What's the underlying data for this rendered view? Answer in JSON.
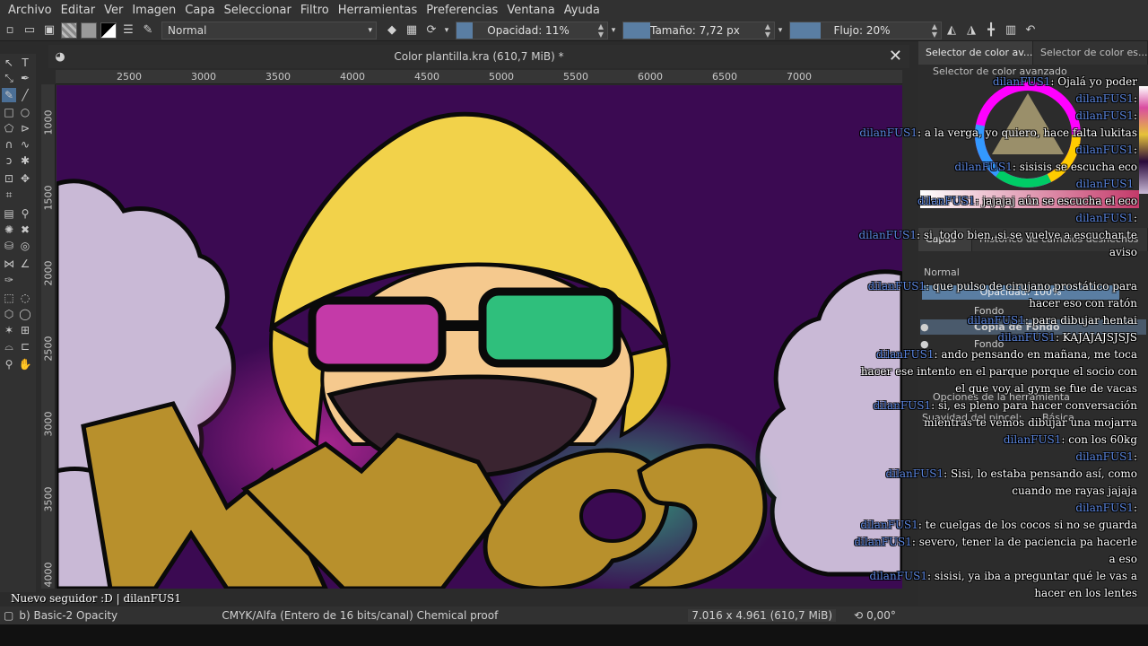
{
  "menu": [
    "Archivo",
    "Editar",
    "Ver",
    "Imagen",
    "Capa",
    "Seleccionar",
    "Filtro",
    "Herramientas",
    "Preferencias",
    "Ventana",
    "Ayuda"
  ],
  "toolbar": {
    "blend_mode": "Normal",
    "opacity_label": "Opacidad: 11%",
    "opacity_value": 0.11,
    "size_label": "Tamaño: 7,72 px",
    "flow_label": "Flujo: 20%",
    "flow_value": 0.2
  },
  "document": {
    "title": "Color plantilla.kra (610,7 MiB) *",
    "close_icon": "✕"
  },
  "ruler": {
    "top_labels": [
      "2500",
      "3000",
      "3500",
      "4000",
      "4500",
      "5000",
      "5500",
      "6000",
      "6500",
      "7000"
    ],
    "left_labels": [
      "1000",
      "1500",
      "2000",
      "2500",
      "3000",
      "3500",
      "4000"
    ]
  },
  "right_panel": {
    "tabs": [
      "Selector de color av...",
      "Selector de color es..."
    ],
    "advanced_selector_title": "Selector de color avanzado",
    "layers_tabs": [
      "Capas",
      "Histórico de cambios deshechos"
    ],
    "layers_blend": "Normal",
    "layers_opacity": "Opacidad:  100%",
    "layers": [
      {
        "name": "Fondo"
      },
      {
        "name": "Copia de Fondo"
      },
      {
        "name": "Fondo"
      }
    ],
    "tool_options_title": "Opciones de la herramienta",
    "brush_smoothing_label": "Suavidad del pincel:",
    "brush_smoothing_value": "Básica"
  },
  "chat": [
    {
      "user": "dilanFUS1",
      "text": ": Ojalá yo poder"
    },
    {
      "user": "dilanFUS1",
      "text": ":"
    },
    {
      "user": "dilanFUS1",
      "text": ":"
    },
    {
      "user": "dilanFUS1",
      "text": ": a la verga, yo quiero, hace falta lukitas"
    },
    {
      "user": "dilanFUS1",
      "text": ":"
    },
    {
      "user": "dilanFUS1",
      "text": ": sisisis se escucha eco"
    },
    {
      "user": "dilanFUS1",
      "text": ""
    },
    {
      "user": "dilanFUS1",
      "text": ": jajajaj aún se escucha el eco"
    },
    {
      "user": "dilanFUS1",
      "text": ":"
    },
    {
      "user": "dilanFUS1",
      "text": ": si, todo bien, si se vuelve a escuchar te"
    },
    {
      "user": "",
      "text": "aviso"
    },
    {
      "user": "",
      "text": ""
    },
    {
      "user": "dilanFUS1",
      "text": ": que pulso de cirujano prostático para"
    },
    {
      "user": "",
      "text": "hacer eso con ratón"
    },
    {
      "user": "dilanFUS1",
      "text": ": para dibujar hentai"
    },
    {
      "user": "dilanFUS1",
      "text": ": KAJAJAJSJSJS"
    },
    {
      "user": "dilanFUS1",
      "text": ": ando pensando en mañana, me toca"
    },
    {
      "user": "",
      "text": "hacer ese intento en el parque porque el socio con"
    },
    {
      "user": "",
      "text": "el que voy al gym se fue de vacas"
    },
    {
      "user": "dilanFUS1",
      "text": ": si, es pleno para hacer conversación"
    },
    {
      "user": "",
      "text": "mientras te vemos dibujar una mojarra"
    },
    {
      "user": "dilanFUS1",
      "text": ": con los 60kg"
    },
    {
      "user": "dilanFUS1",
      "text": ":"
    },
    {
      "user": "dilanFUS1",
      "text": ": Sisi, lo estaba pensando así, como"
    },
    {
      "user": "",
      "text": "cuando me rayas jajaja"
    },
    {
      "user": "dilanFUS1",
      "text": ":"
    },
    {
      "user": "dilanFUS1",
      "text": ": te cuelgas de los cocos si no se guarda"
    },
    {
      "user": "dilanFUS1",
      "text": ": severo, tener la de paciencia pa hacerle"
    },
    {
      "user": "",
      "text": "a eso"
    },
    {
      "user": "dilanFUS1",
      "text": ": sisisi, ya iba a preguntar qué le vas a"
    },
    {
      "user": "",
      "text": "hacer en los lentes"
    }
  ],
  "follow_alert": "Nuevo seguidor :D | dilanFUS1",
  "status": {
    "brush": "b) Basic-2 Opacity",
    "color_space": "CMYK/Alfa (Entero de 16 bits/canal)  Chemical proof",
    "dimensions": "7.016 x 4.961 (610,7 MiB)",
    "rotation": "0,00°"
  },
  "colors": {
    "canvas_bg": "#3b0a52",
    "hood_yellow": "#f2d24a",
    "skin": "#f5c98e",
    "lens_magenta": "#c43aa8",
    "lens_green": "#2fbf7c",
    "letter_gold": "#b8902c",
    "cloud_lilac": "#c9b9d6",
    "accent_blue": "#5a7ea3"
  }
}
